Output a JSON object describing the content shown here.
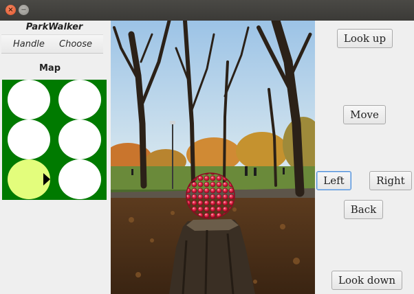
{
  "window": {
    "close_glyph": "×",
    "minimize_glyph": "−"
  },
  "app": {
    "title": "ParkWalker"
  },
  "menu": {
    "items": [
      "Handle",
      "Choose"
    ]
  },
  "map": {
    "label": "Map",
    "colors": {
      "background": "#007a00",
      "empty_cell": "#ffffff",
      "current_cell": "#e3fd7c"
    },
    "current_cell": {
      "row": 3,
      "col": 1,
      "facing": "right"
    }
  },
  "scene": {
    "description_icon": "park-photo",
    "object_icon": "raspberry-icon"
  },
  "controls": {
    "look_up": "Look up",
    "move": "Move",
    "left": "Left",
    "right": "Right",
    "back": "Back",
    "look_down": "Look down",
    "focused": "left"
  }
}
